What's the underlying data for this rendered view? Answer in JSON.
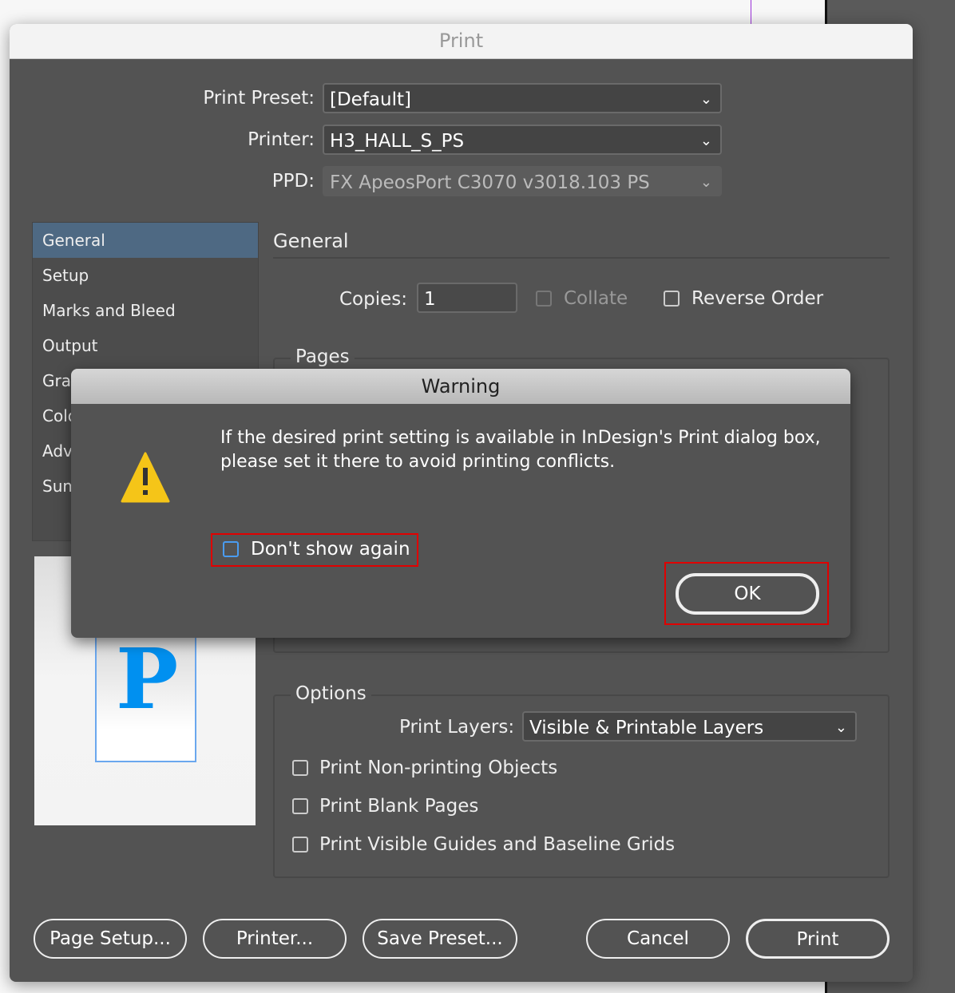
{
  "print_dialog": {
    "title": "Print",
    "print_preset": {
      "label": "Print Preset:",
      "value": "[Default]"
    },
    "printer": {
      "label": "Printer:",
      "value": "H3_HALL_S_PS"
    },
    "ppd": {
      "label": "PPD:",
      "value": "FX ApeosPort C3070 v3018.103 PS"
    },
    "sidebar": {
      "items": [
        {
          "label": "General",
          "selected": true
        },
        {
          "label": "Setup"
        },
        {
          "label": "Marks and Bleed"
        },
        {
          "label": "Output"
        },
        {
          "label": "Graphics"
        },
        {
          "label": "Color Management"
        },
        {
          "label": "Advanced"
        },
        {
          "label": "Summary"
        }
      ]
    },
    "section_title": "General",
    "copies": {
      "label": "Copies:",
      "value": "1"
    },
    "collate": {
      "label": "Collate",
      "checked": false,
      "disabled": true
    },
    "reverse_order": {
      "label": "Reverse Order",
      "checked": false
    },
    "pages_group": "Pages",
    "options": {
      "title": "Options",
      "print_layers": {
        "label": "Print Layers:",
        "value": "Visible & Printable Layers"
      },
      "checks": [
        {
          "label": "Print Non-printing Objects",
          "checked": false
        },
        {
          "label": "Print Blank Pages",
          "checked": false
        },
        {
          "label": "Print Visible Guides and Baseline Grids",
          "checked": false
        }
      ]
    },
    "preview_glyph": "P",
    "buttons": {
      "page_setup": "Page Setup...",
      "printer": "Printer...",
      "save_preset": "Save Preset...",
      "cancel": "Cancel",
      "print": "Print"
    }
  },
  "warning": {
    "title": "Warning",
    "icon": "warning-triangle-icon",
    "message": "If the desired print setting is available in InDesign's Print dialog box, please set it there to avoid printing conflicts.",
    "dont_show_again": {
      "label": "Don't show again",
      "checked": false
    },
    "ok": "OK"
  },
  "colors": {
    "icon_yellow": "#f5c518",
    "highlight_red": "#e00000",
    "selected_item": "#4e6983",
    "preview_blue": "#0090f0"
  }
}
